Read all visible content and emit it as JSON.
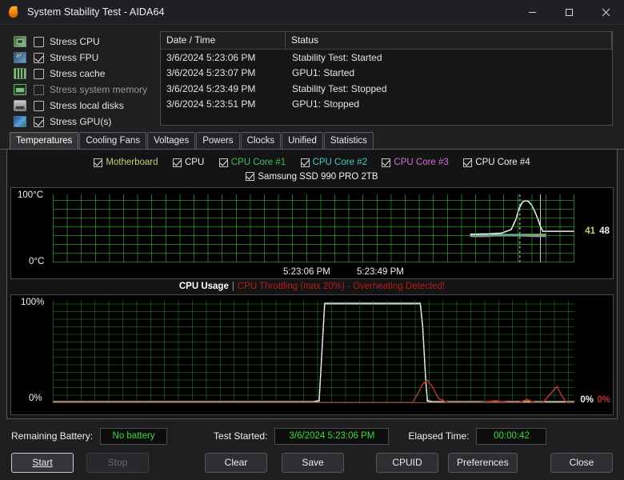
{
  "window": {
    "title": "System Stability Test - AIDA64",
    "app_icon": "flame-icon",
    "minimize": "─",
    "maximize": "☐",
    "close": "✕"
  },
  "stress_options": [
    {
      "label": "Stress CPU",
      "checked": false,
      "icon": "cpu-icon",
      "enabled": true
    },
    {
      "label": "Stress FPU",
      "checked": true,
      "icon": "fpu-icon",
      "enabled": true
    },
    {
      "label": "Stress cache",
      "checked": false,
      "icon": "cache-icon",
      "enabled": true
    },
    {
      "label": "Stress system memory",
      "checked": false,
      "icon": "memory-icon",
      "enabled": false
    },
    {
      "label": "Stress local disks",
      "checked": false,
      "icon": "disk-icon",
      "enabled": true
    },
    {
      "label": "Stress GPU(s)",
      "checked": true,
      "icon": "gpu-icon",
      "enabled": true
    }
  ],
  "log": {
    "columns": [
      "Date / Time",
      "Status"
    ],
    "rows": [
      {
        "datetime": "3/6/2024 5:23:06 PM",
        "status": "Stability Test: Started"
      },
      {
        "datetime": "3/6/2024 5:23:07 PM",
        "status": "GPU1: Started"
      },
      {
        "datetime": "3/6/2024 5:23:49 PM",
        "status": "Stability Test: Stopped"
      },
      {
        "datetime": "3/6/2024 5:23:51 PM",
        "status": "GPU1: Stopped"
      }
    ]
  },
  "tabs": [
    {
      "label": "Temperatures",
      "active": true
    },
    {
      "label": "Cooling Fans",
      "active": false
    },
    {
      "label": "Voltages",
      "active": false
    },
    {
      "label": "Powers",
      "active": false
    },
    {
      "label": "Clocks",
      "active": false
    },
    {
      "label": "Unified",
      "active": false
    },
    {
      "label": "Statistics",
      "active": false
    }
  ],
  "legend": {
    "row1": [
      {
        "label": "Motherboard",
        "color": "#c9c977",
        "checked": true
      },
      {
        "label": "CPU",
        "color": "#f0f0f2",
        "checked": true
      },
      {
        "label": "CPU Core #1",
        "color": "#3fbf5f",
        "checked": true
      },
      {
        "label": "CPU Core #2",
        "color": "#4fc8c8",
        "checked": true
      },
      {
        "label": "CPU Core #3",
        "color": "#d46fd4",
        "checked": true
      },
      {
        "label": "CPU Core #4",
        "color": "#f0f0f2",
        "checked": true
      }
    ],
    "row2": [
      {
        "label": "Samsung SSD 990 PRO 2TB",
        "color": "#f0f0f2",
        "checked": true
      }
    ]
  },
  "chart_data": [
    {
      "type": "line",
      "title": "Temperatures",
      "ylabel": "",
      "xlabel": "",
      "ytick_top": "100°C",
      "ytick_bottom": "0°C",
      "ylim": [
        0,
        100
      ],
      "xtick_left": "5:23:06 PM",
      "xtick_right": "5:23:49 PM",
      "grid": true,
      "grid_color": "#2d8c2d",
      "readouts": [
        {
          "label": "41",
          "color": "#c9c977"
        },
        {
          "label": "48",
          "color": "#f0f0f2"
        }
      ],
      "series": [
        {
          "name": "Motherboard",
          "color": "#c9c977",
          "values": [
            41,
            41,
            41,
            41,
            41,
            41,
            41,
            41,
            41,
            41,
            41,
            41,
            41,
            41,
            41,
            41,
            41,
            41,
            41,
            41,
            41,
            41,
            41,
            41,
            41,
            41,
            41,
            41,
            41,
            41,
            41,
            41,
            41,
            41,
            41,
            41,
            41,
            41,
            41,
            41,
            41,
            41,
            41
          ]
        },
        {
          "name": "CPU",
          "color": "#f0f0f2",
          "values": [
            42,
            42,
            42,
            43,
            44,
            46,
            50,
            58,
            66,
            74,
            82,
            88,
            92,
            95,
            96,
            95,
            93,
            90,
            86,
            80,
            74,
            68,
            62,
            57,
            53,
            50,
            48,
            48,
            48,
            48,
            48,
            48,
            48,
            48,
            48,
            48,
            48,
            48,
            48,
            48,
            48,
            48,
            48
          ]
        },
        {
          "name": "CPU Core #1",
          "color": "#3fbf5f",
          "values": [
            40,
            40,
            40,
            40,
            40,
            41,
            41,
            42,
            42,
            43,
            43,
            43,
            43,
            43,
            43,
            43,
            42,
            42,
            42,
            41,
            41,
            41,
            40,
            40,
            40,
            40,
            40,
            40,
            40,
            40,
            40,
            40,
            40,
            40,
            40,
            40,
            40,
            40,
            40,
            40,
            40,
            40,
            40
          ]
        },
        {
          "name": "CPU Core #2",
          "color": "#4fc8c8",
          "values": [
            39,
            39,
            39,
            39,
            39,
            40,
            40,
            41,
            41,
            42,
            42,
            42,
            42,
            42,
            42,
            41,
            41,
            41,
            40,
            40,
            40,
            39,
            39,
            39,
            39,
            39,
            39,
            39,
            39,
            39,
            39,
            39,
            39,
            39,
            39,
            39,
            39,
            39,
            39,
            39,
            39,
            39,
            39
          ]
        },
        {
          "name": "CPU Core #3",
          "color": "#d46fd4",
          "values": [
            38,
            38,
            38,
            38,
            38,
            39,
            39,
            40,
            40,
            40,
            41,
            41,
            41,
            41,
            40,
            40,
            40,
            39,
            39,
            39,
            38,
            38,
            38,
            38,
            38,
            38,
            38,
            38,
            38,
            38,
            38,
            38,
            38,
            38,
            38,
            38,
            38,
            38,
            38,
            38,
            38,
            38,
            38
          ]
        },
        {
          "name": "CPU Core #4",
          "color": "#f0f0f2",
          "values": [
            37,
            37,
            37,
            37,
            38,
            38,
            39,
            39,
            40,
            40,
            40,
            40,
            40,
            40,
            40,
            39,
            39,
            39,
            38,
            38,
            38,
            37,
            37,
            37,
            37,
            37,
            37,
            37,
            37,
            37,
            37,
            37,
            37,
            37,
            37,
            37,
            37,
            37,
            37,
            37,
            37,
            37,
            37
          ]
        }
      ]
    },
    {
      "type": "line",
      "title": "CPU Usage",
      "warning": "CPU Throttling (max 20%) - Overheating Detected!",
      "separator": "|",
      "ytick_top": "100%",
      "ytick_bottom": "0%",
      "ylim": [
        0,
        100
      ],
      "grid": true,
      "grid_color": "#2d8c2d",
      "readouts": [
        {
          "label": "0%",
          "color": "#f0f0f2"
        },
        {
          "label": "0%",
          "color": "#c03030"
        }
      ],
      "series": [
        {
          "name": "CPU Usage",
          "color": "#f0f0f2",
          "values": [
            1,
            1,
            1,
            1,
            1,
            1,
            1,
            1,
            1,
            1,
            1,
            1,
            1,
            1,
            1,
            1,
            1,
            1,
            1,
            1,
            1,
            1,
            1,
            1,
            1,
            1,
            1,
            1,
            1,
            1,
            1,
            1,
            1,
            1,
            2,
            100,
            100,
            100,
            100,
            100,
            100,
            100,
            100,
            100,
            100,
            100,
            100,
            100,
            100,
            100,
            100,
            100,
            100,
            100,
            100,
            100,
            100,
            100,
            100,
            100,
            100,
            100,
            50,
            3,
            1,
            1,
            1,
            1,
            1,
            1,
            1,
            1,
            1,
            1,
            1,
            1,
            1,
            1,
            1,
            1,
            1,
            1,
            1,
            1,
            1,
            1,
            1,
            1,
            1,
            1,
            1,
            1,
            1,
            1,
            1,
            1,
            1,
            1,
            1,
            1
          ]
        },
        {
          "name": "CPU Throttling",
          "color": "#c03030",
          "values": [
            0,
            0,
            0,
            0,
            0,
            0,
            0,
            0,
            0,
            0,
            0,
            0,
            0,
            0,
            0,
            0,
            0,
            0,
            0,
            0,
            0,
            0,
            0,
            0,
            0,
            0,
            0,
            0,
            0,
            0,
            0,
            0,
            0,
            0,
            0,
            0,
            0,
            0,
            0,
            0,
            0,
            0,
            0,
            0,
            0,
            0,
            0,
            0,
            0,
            0,
            0,
            0,
            0,
            0,
            0,
            0,
            0,
            0,
            0,
            0,
            0,
            0,
            0,
            0,
            0,
            0,
            0,
            0,
            0,
            0,
            0,
            0,
            8,
            14,
            20,
            16,
            8,
            2,
            0,
            0,
            0,
            0,
            2,
            0,
            3,
            0,
            2,
            0,
            0,
            0,
            0,
            0,
            6,
            10,
            4,
            0,
            0,
            5,
            3,
            0
          ]
        }
      ]
    }
  ],
  "status": {
    "battery_label": "Remaining Battery:",
    "battery_value": "No battery",
    "started_label": "Test Started:",
    "started_value": "3/6/2024 5:23:06 PM",
    "elapsed_label": "Elapsed Time:",
    "elapsed_value": "00:00:42"
  },
  "buttons": {
    "start": "Start",
    "stop": "Stop",
    "clear": "Clear",
    "save": "Save",
    "cpuid": "CPUID",
    "preferences": "Preferences",
    "close": "Close"
  }
}
